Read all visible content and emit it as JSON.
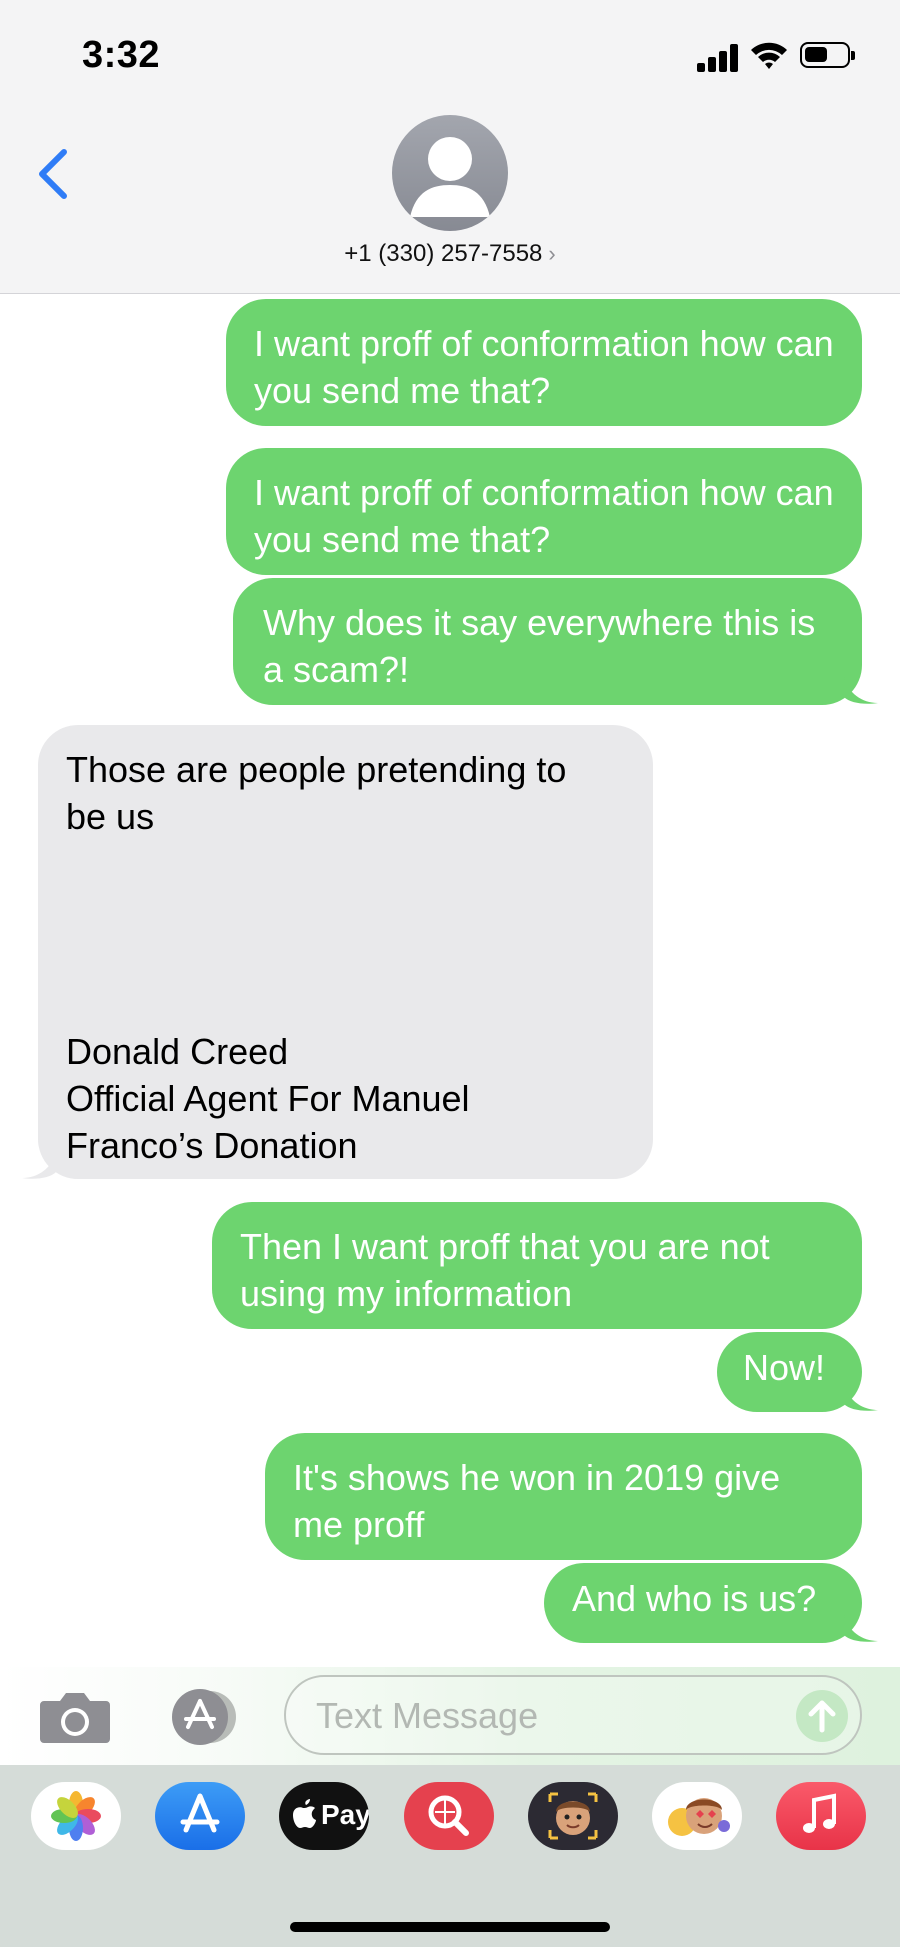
{
  "status_bar": {
    "time": "3:32"
  },
  "header": {
    "contact": "+1 (330) 257-7558",
    "chevron": "›"
  },
  "messages": [
    {
      "type": "sent",
      "text": "I want proff of conformation how can you send me that?"
    },
    {
      "type": "sent",
      "text": "I want proff of conformation how can you send me that?"
    },
    {
      "type": "sent",
      "text": "Why does it say everywhere this is a scam?!"
    },
    {
      "type": "received",
      "line1": "Those are people pretending to",
      "line2": "be us",
      "line3": "Donald Creed",
      "line4": "Official Agent For Manuel",
      "line5": "Franco’s Donation"
    },
    {
      "type": "sent",
      "text": "Then I want proff that you are not using my information"
    },
    {
      "type": "sent",
      "text": "Now!"
    },
    {
      "type": "sent",
      "text": "It's shows he won in 2019 give me proff"
    },
    {
      "type": "sent",
      "text": "And who is us?"
    }
  ],
  "input": {
    "placeholder": "Text Message"
  },
  "app_drawer": {
    "apps": [
      "photos-icon",
      "app-store-icon",
      "apple-pay-icon",
      "web-search-icon",
      "memoji-icon",
      "memoji-stickers-icon",
      "music-icon"
    ],
    "apple_pay_label": "Pay"
  },
  "colors": {
    "sent_bubble": "#6dd46f",
    "received_bubble": "#e9e9eb",
    "accent": "#2f7cf6"
  }
}
